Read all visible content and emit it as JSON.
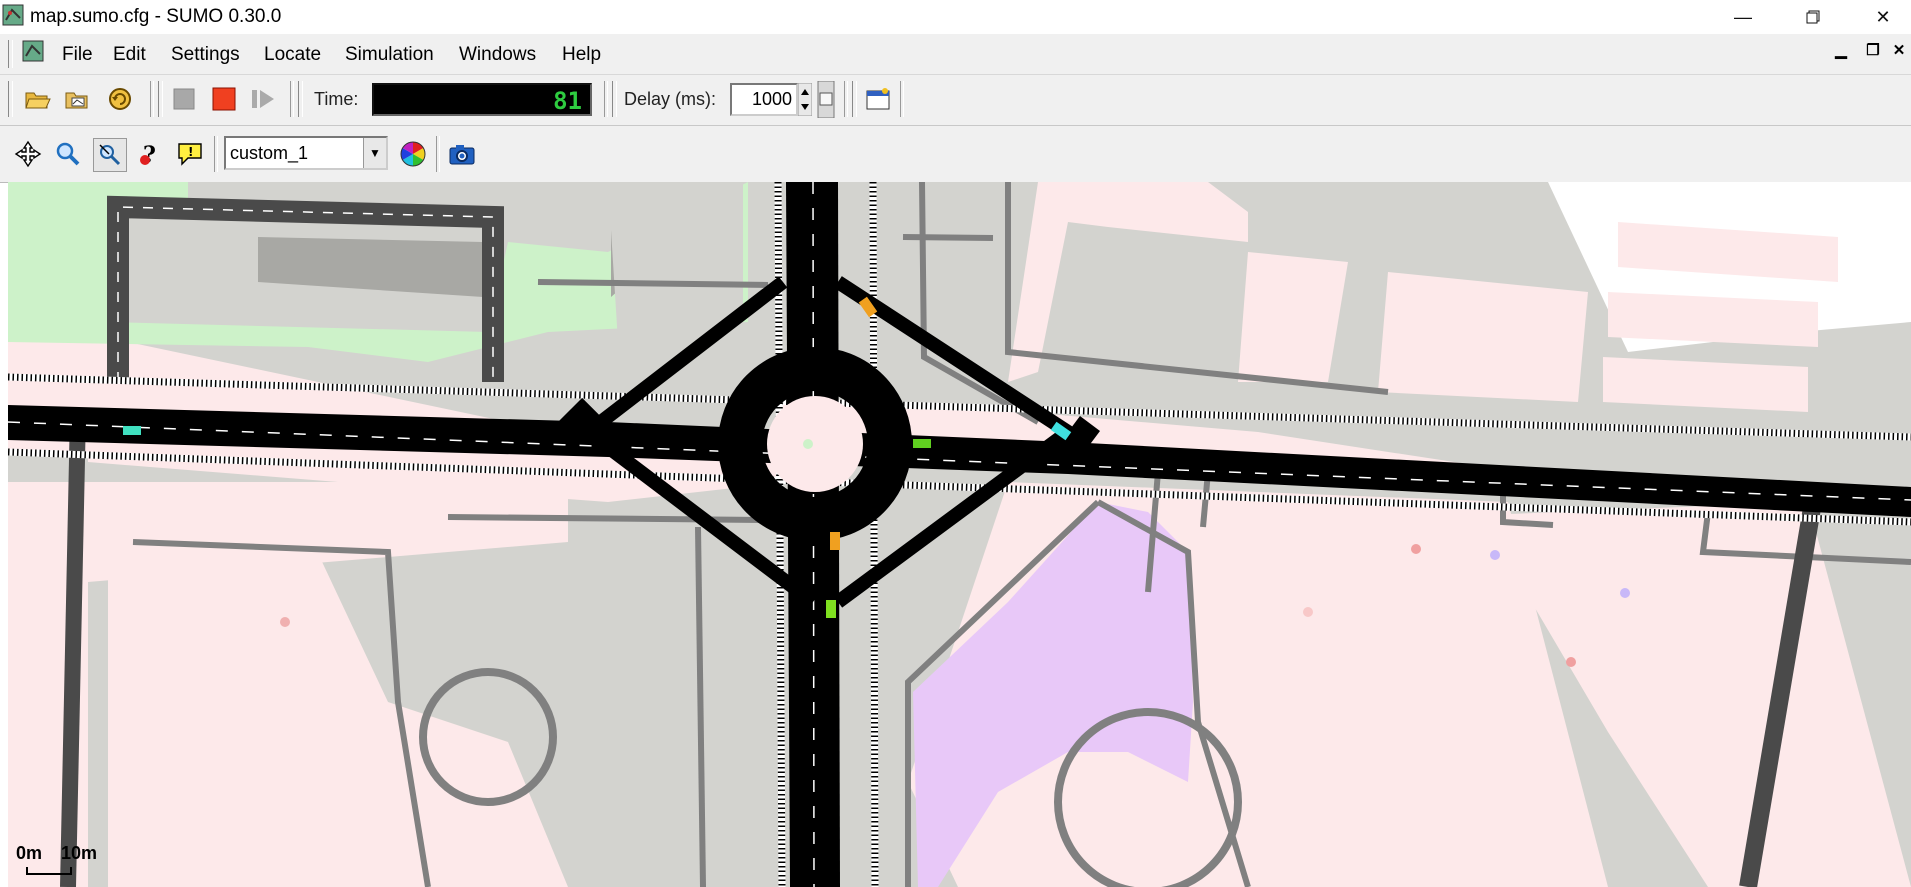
{
  "window": {
    "title": "map.sumo.cfg - SUMO 0.30.0",
    "controls": [
      "minimize-icon",
      "restore-icon",
      "close-icon"
    ]
  },
  "menu": {
    "items": [
      "File",
      "Edit",
      "Settings",
      "Locate",
      "Simulation",
      "Windows",
      "Help"
    ]
  },
  "toolbar": {
    "time_label": "Time:",
    "time_value": "81",
    "delay_label": "Delay (ms):",
    "delay_value": "1000",
    "icons": [
      "open-folder-icon",
      "open-network-icon",
      "reload-icon",
      "stop-icon",
      "step-icon",
      "new-view-icon"
    ]
  },
  "view_toolbar": {
    "scheme_value": "custom_1",
    "icons": [
      "recenter-icon",
      "zoom-icon",
      "locate-icon",
      "query-icon",
      "tooltip-icon",
      "color-wheel-icon",
      "camera-icon"
    ]
  },
  "scale": {
    "start": "0m",
    "end": "10m"
  },
  "colors": {
    "road": "#000000",
    "background": "#fde9ea",
    "area_grey": "#d3d3cf",
    "park_green": "#cdf2c9",
    "purple_area": "#e8c8f8",
    "time_digit": "#2ecc40"
  }
}
